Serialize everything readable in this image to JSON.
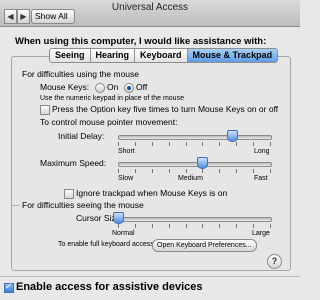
{
  "window": {
    "title": "Universal Access",
    "show_all": "Show All"
  },
  "intro": "When using this computer, I would like assistance with:",
  "tabs": [
    "Seeing",
    "Hearing",
    "Keyboard",
    "Mouse & Trackpad"
  ],
  "active_tab": "Mouse & Trackpad",
  "mobility": {
    "section": "For difficulties using the mouse",
    "mouse_keys_label": "Mouse Keys:",
    "on_label": "On",
    "off_label": "Off",
    "mouse_keys_selected": "Off",
    "numeric_hint": "Use the numeric keypad in place of the mouse",
    "option_key_label": "Press the Option key five times to turn Mouse Keys on or off",
    "option_key_checked": false,
    "control_label": "To control mouse pointer movement:",
    "initial_delay": {
      "label": "Initial Delay:",
      "min_label": "Short",
      "max_label": "Long",
      "value": 0.75
    },
    "max_speed": {
      "label": "Maximum Speed:",
      "min_label": "Slow",
      "mid_label": "Medium",
      "max_label": "Fast",
      "value": 0.55
    },
    "ignore_trackpad_label": "Ignore trackpad when Mouse Keys is on",
    "ignore_trackpad_checked": false
  },
  "seeing": {
    "section": "For difficulties seeing the mouse",
    "cursor_label": "Cursor Size:",
    "min_label": "Normal",
    "max_label": "Large",
    "value": 0.0
  },
  "full_keyboard": {
    "label": "To enable full keyboard access:",
    "button": "Open Keyboard Preferences..."
  },
  "help": "?",
  "footer": {
    "enable_label": "Enable access for assistive devices",
    "checked": true
  }
}
